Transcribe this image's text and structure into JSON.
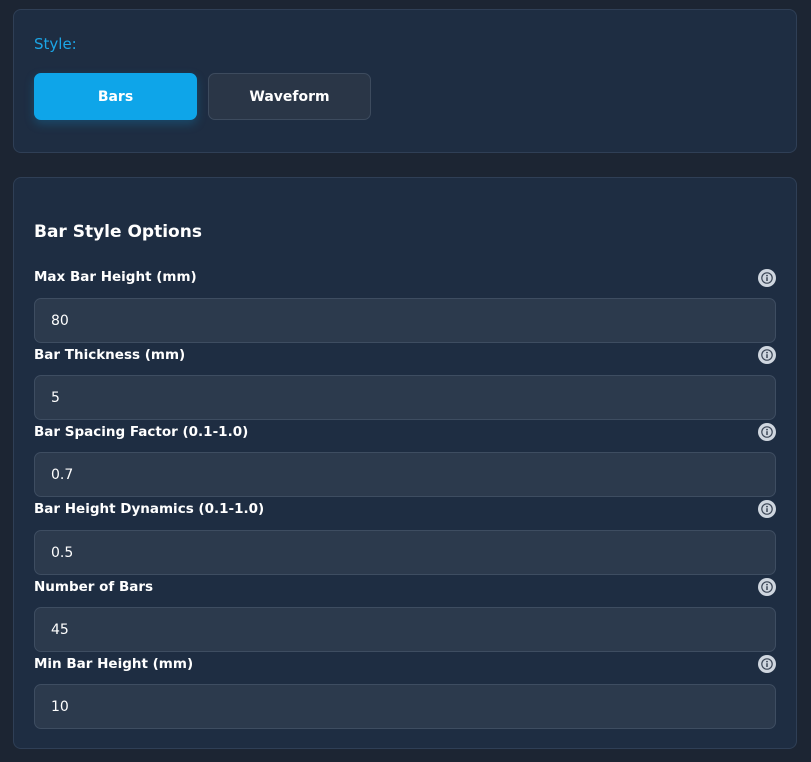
{
  "style_panel": {
    "label": "Style:",
    "buttons": [
      {
        "label": "Bars",
        "active": true
      },
      {
        "label": "Waveform",
        "active": false
      }
    ]
  },
  "options_panel": {
    "title": "Bar Style Options",
    "fields": [
      {
        "label": "Max Bar Height (mm)",
        "value": "80"
      },
      {
        "label": "Bar Thickness (mm)",
        "value": "5"
      },
      {
        "label": "Bar Spacing Factor (0.1-1.0)",
        "value": "0.7"
      },
      {
        "label": "Bar Height Dynamics (0.1-1.0)",
        "value": "0.5"
      },
      {
        "label": "Number of Bars",
        "value": "45"
      },
      {
        "label": "Min Bar Height (mm)",
        "value": "10"
      }
    ]
  },
  "icons": {
    "info": "info-icon"
  },
  "colors": {
    "accent": "#0ea5e9",
    "style_label": "#1ba5e6",
    "panel_bg": "#1e2d42",
    "input_bg": "#2c3a4d"
  }
}
